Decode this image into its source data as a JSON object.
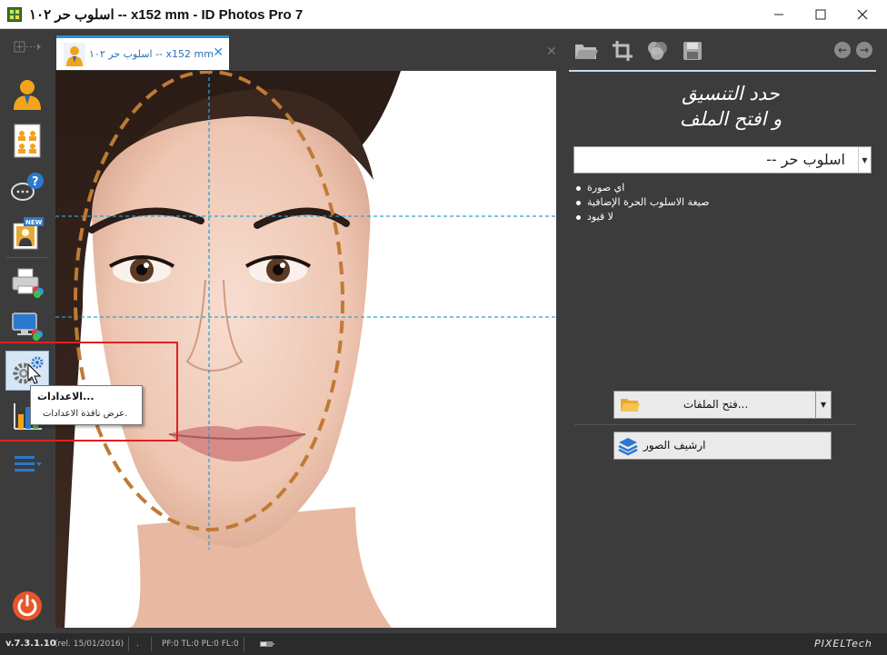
{
  "window": {
    "title": "اسلوب حر ١٠٢ -- x152 mm - ID Photos Pro 7",
    "minimize_icon": "minimize-icon",
    "maximize_icon": "maximize-icon",
    "close_icon": "close-icon"
  },
  "left_toolbar": {
    "items": [
      {
        "name": "add-arrow-icon"
      },
      {
        "name": "person-photo-icon"
      },
      {
        "name": "photo-sheet-icon"
      },
      {
        "name": "help-chat-icon"
      },
      {
        "name": "new-template-icon",
        "badge": "NEW"
      },
      {
        "name": "printer-icon"
      },
      {
        "name": "monitor-color-icon"
      },
      {
        "name": "settings-gear-icon"
      },
      {
        "name": "statistics-chart-icon"
      },
      {
        "name": "menu-list-icon"
      },
      {
        "name": "power-icon"
      }
    ]
  },
  "document_tab": {
    "label": "اسلوب حر ١٠٢ -- x152 mm",
    "close_glyph": "✕"
  },
  "tooltip": {
    "title": "الاعدادات...",
    "description": "عرض نافذة الاعدادات."
  },
  "right_panel": {
    "toolbar_icons": [
      "folder-open-icon",
      "crop-icon",
      "color-adjust-icon",
      "save-disk-icon"
    ],
    "nav": {
      "back": "←",
      "forward": "→"
    },
    "headline_line1": "حدد التنسيق",
    "headline_line2": "و افتح الملف",
    "format_select": {
      "value": "اسلوب حر --"
    },
    "bullets": [
      "اي صورة",
      "صيغة الاسلوب الحرة الإضافية",
      "لا قيود"
    ],
    "open_button": "فتح الملفات...",
    "archive_button": "ارشيف الصور"
  },
  "status_bar": {
    "version": "v.7.3.1.10",
    "release": "(rel. 15/01/2016)",
    "dot": ".",
    "counters": "PF:0 TL:0 PL:0 FL:0",
    "brand": "PIXELTech"
  },
  "colors": {
    "accent_blue": "#2b8fd6",
    "face_oval": "#c07a35",
    "guide_lines": "#2aa0d8",
    "highlight_red": "#e02020"
  }
}
